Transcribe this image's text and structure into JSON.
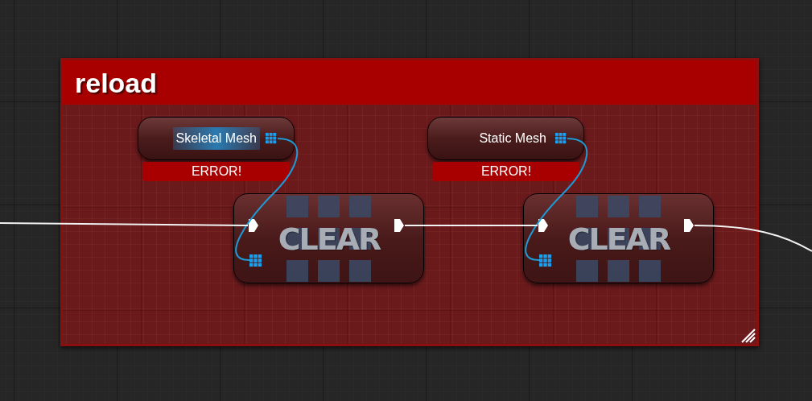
{
  "comment": {
    "title": "reload"
  },
  "pairs": [
    {
      "variable": {
        "label": "Skeletal Mesh",
        "highlighted": true,
        "error": "ERROR!"
      },
      "function": {
        "title": "CLEAR"
      }
    },
    {
      "variable": {
        "label": "Static Mesh",
        "highlighted": false,
        "error": "ERROR!"
      },
      "function": {
        "title": "CLEAR"
      }
    }
  ]
}
